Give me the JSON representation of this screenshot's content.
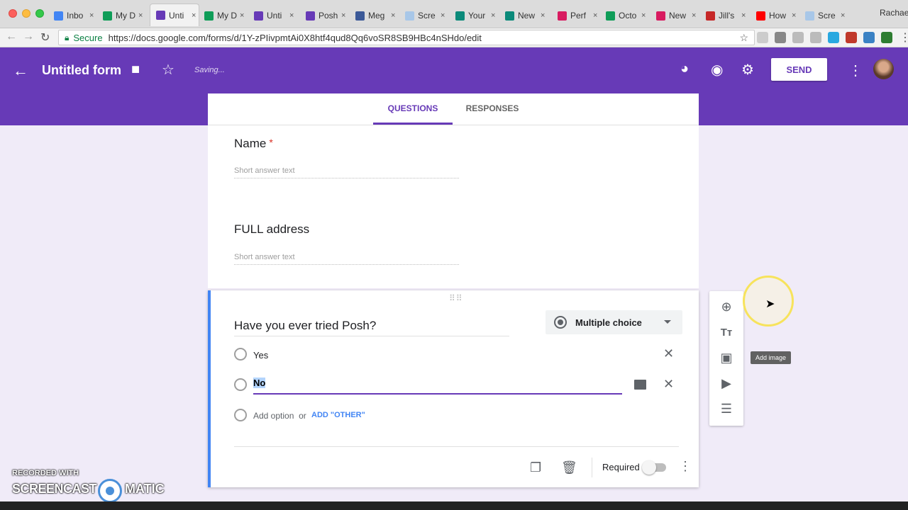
{
  "browser": {
    "tabs": [
      {
        "label": "Inbo",
        "fav_color": "#4285f4"
      },
      {
        "label": "My D",
        "fav_color": "#0f9d58"
      },
      {
        "label": "Unti",
        "fav_color": "#673ab7",
        "active": true
      },
      {
        "label": "My D",
        "fav_color": "#0f9d58"
      },
      {
        "label": "Unti",
        "fav_color": "#673ab7"
      },
      {
        "label": "Posh",
        "fav_color": "#673ab7"
      },
      {
        "label": "Meg",
        "fav_color": "#3b5998"
      },
      {
        "label": "Scre",
        "fav_color": "#a8c7e8"
      },
      {
        "label": "Your",
        "fav_color": "#0b8a7a"
      },
      {
        "label": "New",
        "fav_color": "#0b8a7a"
      },
      {
        "label": "Perf",
        "fav_color": "#d81b60"
      },
      {
        "label": "Octo",
        "fav_color": "#0f9d58"
      },
      {
        "label": "New",
        "fav_color": "#d81b60"
      },
      {
        "label": "Jill's",
        "fav_color": "#c62828"
      },
      {
        "label": "How",
        "fav_color": "#ff0000"
      },
      {
        "label": "Scre",
        "fav_color": "#a8c7e8"
      }
    ],
    "tab_close": "×",
    "profile_name": "Rachael",
    "secure_label": "Secure",
    "url": "https://docs.google.com/forms/d/1Y-zPIivpmtAi0X8htf4qud8Qq6voSR8SB9HBc4nSHdo/edit"
  },
  "header": {
    "title": "Untitled form",
    "status": "Saving...",
    "send_label": "SEND",
    "accent_color": "#673ab7"
  },
  "tabs": {
    "questions": "QUESTIONS",
    "responses": "RESPONSES"
  },
  "questions": [
    {
      "title": "Name",
      "required": true,
      "placeholder": "Short answer text"
    },
    {
      "title": "FULL address",
      "required": false,
      "placeholder": "Short answer text"
    }
  ],
  "active_question": {
    "title": "Have you ever tried Posh?",
    "type": "Multiple choice",
    "options": [
      "Yes",
      "No"
    ],
    "add_option": "Add option",
    "or": "or",
    "add_other": "ADD \"OTHER\"",
    "required_label": "Required",
    "required": false
  },
  "side_toolbar": {
    "icons": [
      "add-question-icon",
      "add-title-icon",
      "add-image-icon",
      "add-video-icon",
      "add-section-icon"
    ],
    "tooltip": "Add image"
  },
  "watermark": {
    "top": "RECORDED WITH",
    "main": "SCREENCAST",
    "matic": "MATIC"
  }
}
